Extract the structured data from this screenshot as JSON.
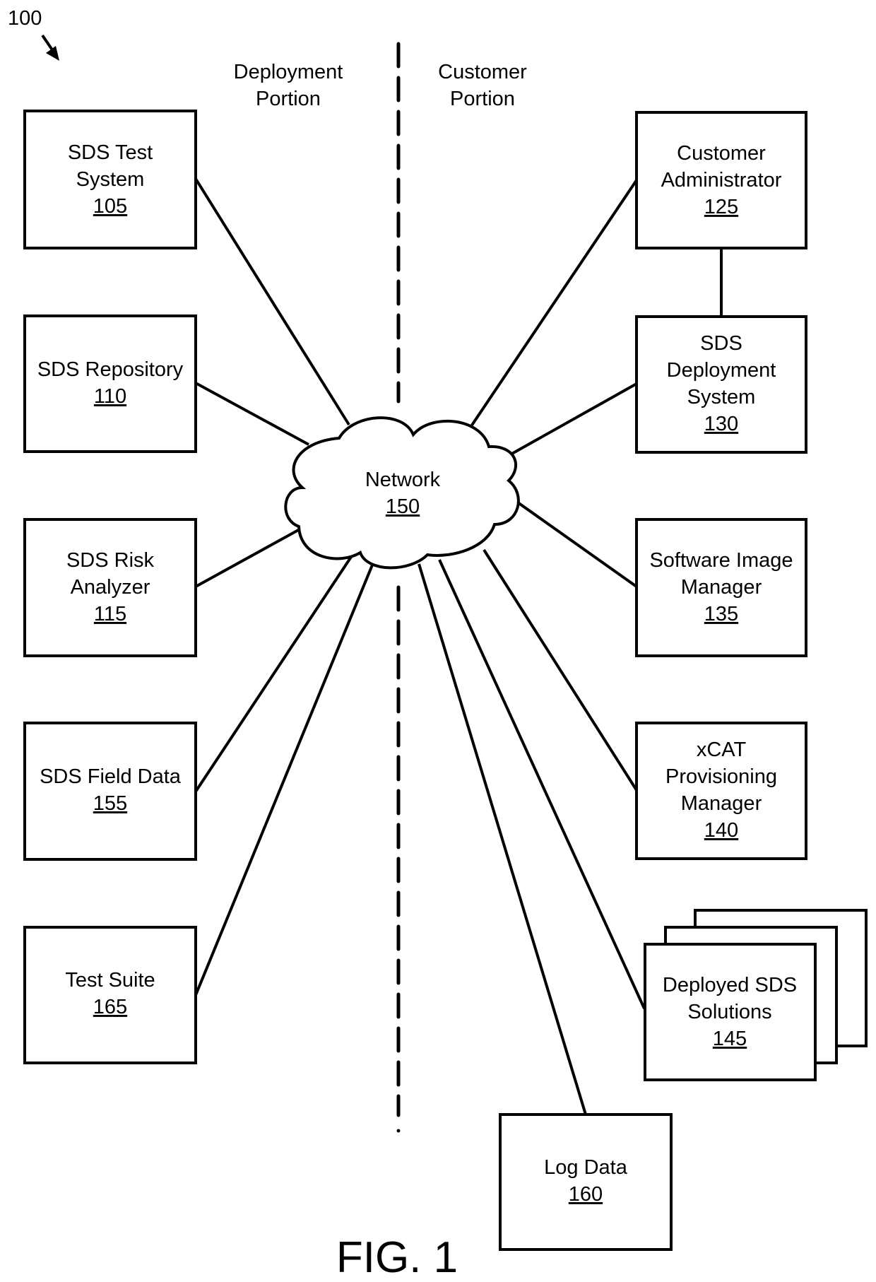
{
  "figure": {
    "reference_number": "100",
    "caption": "FIG. 1"
  },
  "portions": {
    "deployment": {
      "line1": "Deployment",
      "line2": "Portion"
    },
    "customer": {
      "line1": "Customer",
      "line2": "Portion"
    }
  },
  "network": {
    "label": "Network",
    "ref": "150"
  },
  "deployment_nodes": [
    {
      "id": "sds-test-system",
      "lines": [
        "SDS Test",
        "System"
      ],
      "ref": "105"
    },
    {
      "id": "sds-repository",
      "lines": [
        "SDS Repository"
      ],
      "ref": "110"
    },
    {
      "id": "sds-risk-analyzer",
      "lines": [
        "SDS Risk",
        "Analyzer"
      ],
      "ref": "115"
    },
    {
      "id": "sds-field-data",
      "lines": [
        "SDS Field Data"
      ],
      "ref": "155"
    },
    {
      "id": "test-suite",
      "lines": [
        "Test Suite"
      ],
      "ref": "165"
    }
  ],
  "customer_nodes": [
    {
      "id": "customer-administrator",
      "lines": [
        "Customer",
        "Administrator"
      ],
      "ref": "125"
    },
    {
      "id": "sds-deployment-system",
      "lines": [
        "SDS",
        "Deployment",
        "System"
      ],
      "ref": "130"
    },
    {
      "id": "software-image-manager",
      "lines": [
        "Software Image",
        "Manager"
      ],
      "ref": "135"
    },
    {
      "id": "xcat-provisioning-manager",
      "lines": [
        "xCAT",
        "Provisioning",
        "Manager"
      ],
      "ref": "140"
    },
    {
      "id": "deployed-sds-solutions",
      "lines": [
        "Deployed SDS",
        "Solutions"
      ],
      "ref": "145",
      "stacked": true
    }
  ],
  "bottom_node": {
    "id": "log-data",
    "lines": [
      "Log Data"
    ],
    "ref": "160"
  },
  "connections": [
    {
      "from": "105",
      "to": "150"
    },
    {
      "from": "110",
      "to": "150"
    },
    {
      "from": "115",
      "to": "150"
    },
    {
      "from": "155",
      "to": "150"
    },
    {
      "from": "165",
      "to": "150"
    },
    {
      "from": "125",
      "to": "150"
    },
    {
      "from": "125",
      "to": "130"
    },
    {
      "from": "130",
      "to": "150"
    },
    {
      "from": "135",
      "to": "150"
    },
    {
      "from": "140",
      "to": "150"
    },
    {
      "from": "145",
      "to": "150"
    },
    {
      "from": "160",
      "to": "150"
    }
  ]
}
